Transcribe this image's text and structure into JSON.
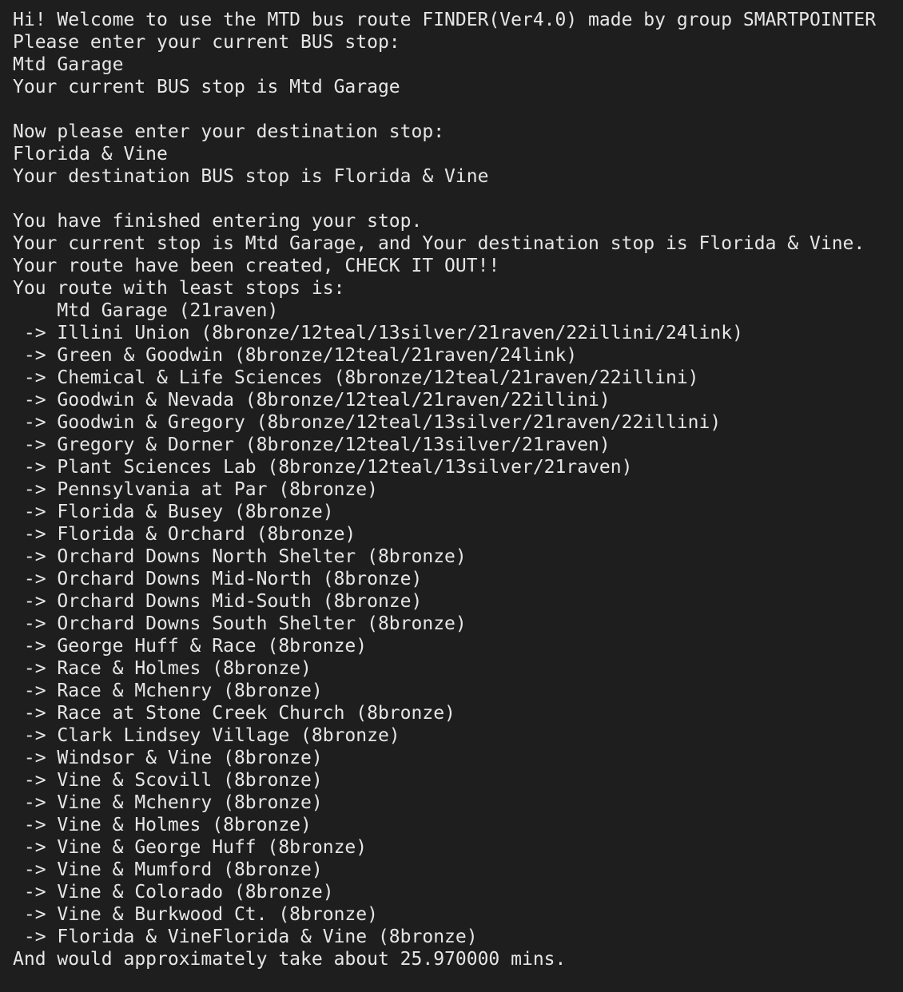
{
  "terminal": {
    "background": "#1e1e1e",
    "foreground": "#e6e6e6",
    "lines": [
      "Hi! Welcome to use the MTD bus route FINDER(Ver4.0) made by group SMARTPOINTER",
      "Please enter your current BUS stop:",
      "Mtd Garage",
      "Your current BUS stop is Mtd Garage",
      "",
      "Now please enter your destination stop:",
      "Florida & Vine",
      "Your destination BUS stop is Florida & Vine",
      "",
      "You have finished entering your stop.",
      "Your current stop is Mtd Garage, and Your destination stop is Florida & Vine.",
      "Your route have been created, CHECK IT OUT!!",
      "You route with least stops is:",
      "    Mtd Garage (21raven)",
      " -> Illini Union (8bronze/12teal/13silver/21raven/22illini/24link)",
      " -> Green & Goodwin (8bronze/12teal/21raven/24link)",
      " -> Chemical & Life Sciences (8bronze/12teal/21raven/22illini)",
      " -> Goodwin & Nevada (8bronze/12teal/21raven/22illini)",
      " -> Goodwin & Gregory (8bronze/12teal/13silver/21raven/22illini)",
      " -> Gregory & Dorner (8bronze/12teal/13silver/21raven)",
      " -> Plant Sciences Lab (8bronze/12teal/13silver/21raven)",
      " -> Pennsylvania at Par (8bronze)",
      " -> Florida & Busey (8bronze)",
      " -> Florida & Orchard (8bronze)",
      " -> Orchard Downs North Shelter (8bronze)",
      " -> Orchard Downs Mid-North (8bronze)",
      " -> Orchard Downs Mid-South (8bronze)",
      " -> Orchard Downs South Shelter (8bronze)",
      " -> George Huff & Race (8bronze)",
      " -> Race & Holmes (8bronze)",
      " -> Race & Mchenry (8bronze)",
      " -> Race at Stone Creek Church (8bronze)",
      " -> Clark Lindsey Village (8bronze)",
      " -> Windsor & Vine (8bronze)",
      " -> Vine & Scovill (8bronze)",
      " -> Vine & Mchenry (8bronze)",
      " -> Vine & Holmes (8bronze)",
      " -> Vine & George Huff (8bronze)",
      " -> Vine & Mumford (8bronze)",
      " -> Vine & Colorado (8bronze)",
      " -> Vine & Burkwood Ct. (8bronze)",
      " -> Florida & VineFlorida & Vine (8bronze)",
      "And would approximately take about 25.970000 mins."
    ]
  }
}
